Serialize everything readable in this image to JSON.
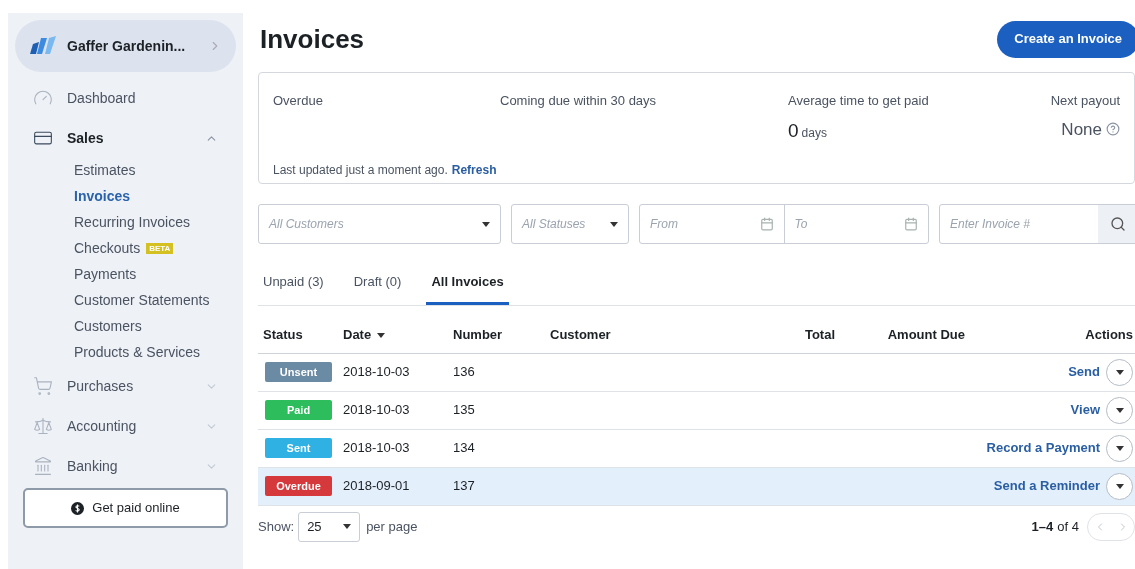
{
  "sidebar": {
    "business": "Gaffer Gardenin...",
    "items": [
      {
        "label": "Dashboard",
        "selected": false
      },
      {
        "label": "Sales",
        "expanded": true,
        "selected": true,
        "children": [
          {
            "label": "Estimates",
            "selected": false
          },
          {
            "label": "Invoices",
            "selected": true
          },
          {
            "label": "Recurring Invoices",
            "selected": false
          },
          {
            "label": "Checkouts",
            "badge": "BETA",
            "selected": false
          },
          {
            "label": "Payments",
            "selected": false
          },
          {
            "label": "Customer Statements",
            "selected": false
          },
          {
            "label": "Customers",
            "selected": false
          },
          {
            "label": "Products & Services",
            "selected": false
          }
        ]
      },
      {
        "label": "Purchases",
        "expanded": false,
        "selected": false
      },
      {
        "label": "Accounting",
        "expanded": false,
        "selected": false
      },
      {
        "label": "Banking",
        "expanded": false,
        "selected": false
      }
    ],
    "cta": "Get paid online"
  },
  "page": {
    "title": "Invoices",
    "create_button": "Create an Invoice"
  },
  "summary": {
    "overdue_label": "Overdue",
    "coming_due_label": "Coming due within 30 days",
    "avg_label": "Average time to get paid",
    "avg_value": "0",
    "avg_unit": "days",
    "payout_label": "Next payout",
    "payout_value": "None",
    "updated": "Last updated just a moment ago.",
    "refresh": "Refresh"
  },
  "filters": {
    "customers": "All Customers",
    "statuses": "All Statuses",
    "from": "From",
    "to": "To",
    "invoice": "Enter Invoice #"
  },
  "tabs": [
    {
      "label": "Unpaid (3)",
      "selected": false
    },
    {
      "label": "Draft (0)",
      "selected": false
    },
    {
      "label": "All Invoices",
      "selected": true
    }
  ],
  "table": {
    "columns": [
      "Status",
      "Date",
      "Number",
      "Customer",
      "Total",
      "Amount Due",
      "Actions"
    ],
    "rows": [
      {
        "status": "Unsent",
        "color": "#6b8aa3",
        "date": "2018-10-03",
        "number": "136",
        "action": "Send",
        "selected": false
      },
      {
        "status": "Paid",
        "color": "#2dbd5d",
        "date": "2018-10-03",
        "number": "135",
        "action": "View",
        "selected": false
      },
      {
        "status": "Sent",
        "color": "#2fb1e3",
        "date": "2018-10-03",
        "number": "134",
        "action": "Record a Payment",
        "selected": false
      },
      {
        "status": "Overdue",
        "color": "#d6393b",
        "date": "2018-09-01",
        "number": "137",
        "action": "Send a Reminder",
        "selected": true
      }
    ]
  },
  "footer": {
    "show": "Show:",
    "per_page_value": "25",
    "per_page": "per page",
    "range": "1–4",
    "of": "of 4"
  }
}
